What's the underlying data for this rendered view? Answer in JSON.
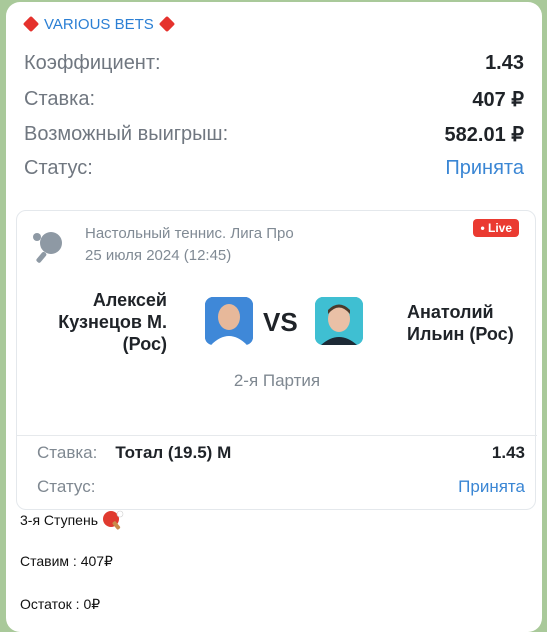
{
  "sender": {
    "name": "VARIOUS BETS",
    "accent": "#2b7fd4",
    "decor_icon": "red-diamond-icon"
  },
  "summary": {
    "rows": [
      {
        "label": "Коэффициент:",
        "value": "1.43"
      },
      {
        "label": "Ставка:",
        "value": "407 ₽"
      },
      {
        "label": "Возможный выигрыш:",
        "value": "582.01 ₽"
      },
      {
        "label": "Статус:",
        "value": "Принята"
      }
    ]
  },
  "event": {
    "sport_icon": "table-tennis-icon",
    "league": "Настольный теннис. Лига Про",
    "date": "25 июля 2024 (12:45)",
    "live_badge": "• Live",
    "player1": {
      "name_line1": "Алексей",
      "name_line2": "Кузнецов М.",
      "name_line3": "(Рос)"
    },
    "player2": {
      "name_line1": "Анатолий",
      "name_line2": "Ильин (Рос)"
    },
    "vs": "VS",
    "period": "2-я Партия",
    "bet": {
      "label": "Ставка:",
      "market": "Тотал (19.5) М",
      "odds": "1.43"
    },
    "status": {
      "label": "Статус:",
      "value": "Принята"
    }
  },
  "message": {
    "lines": [
      "3-я Ступень",
      "Ставим : 407₽",
      "Остаток : 0₽"
    ],
    "emoji": "ping-pong-paddle-icon"
  },
  "colors": {
    "live": "#ea3a31",
    "status_accepted": "#3a86d4"
  }
}
